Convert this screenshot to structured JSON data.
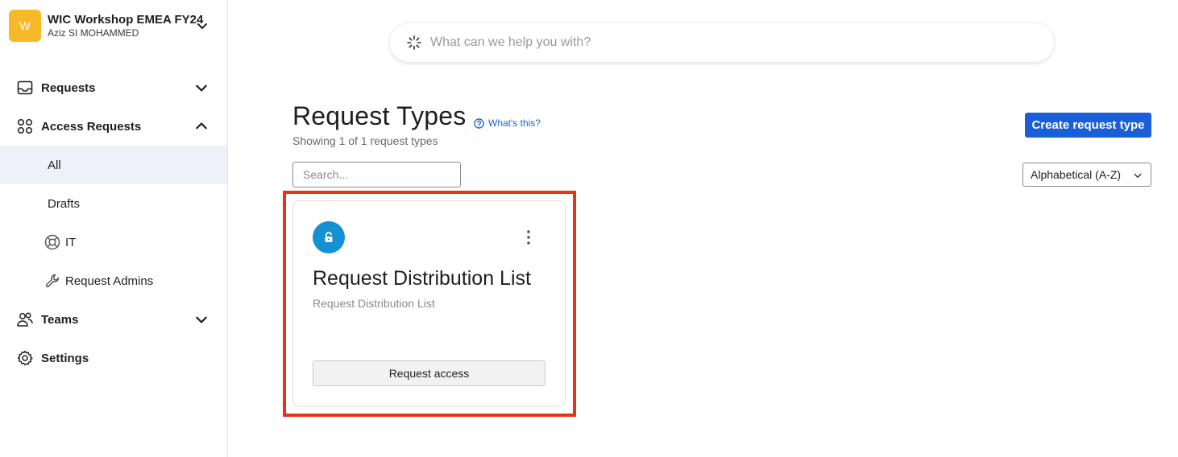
{
  "workspace": {
    "avatar_letter": "W",
    "name": "WIC Workshop EMEA FY24",
    "user": "Aziz SI MOHAMMED"
  },
  "sidebar": {
    "requests_label": "Requests",
    "access_requests_label": "Access Requests",
    "sub_items": {
      "all": "All",
      "drafts": "Drafts",
      "it": "IT",
      "request_admins": "Request Admins"
    },
    "teams_label": "Teams",
    "settings_label": "Settings"
  },
  "search": {
    "placeholder": "What can we help you with?"
  },
  "main": {
    "title": "Request Types",
    "whats_this": "What's this?",
    "count_text": "Showing 1 of 1 request types",
    "create_button": "Create request type",
    "search_placeholder": "Search...",
    "sort_value": "Alphabetical (A-Z)"
  },
  "card": {
    "title": "Request Distribution List",
    "subtitle": "Request Distribution List",
    "button": "Request access"
  },
  "colors": {
    "accent": "#1a5fd8",
    "avatar": "#f7b928",
    "lock_badge": "#1590d0",
    "highlight": "#e8321c"
  }
}
